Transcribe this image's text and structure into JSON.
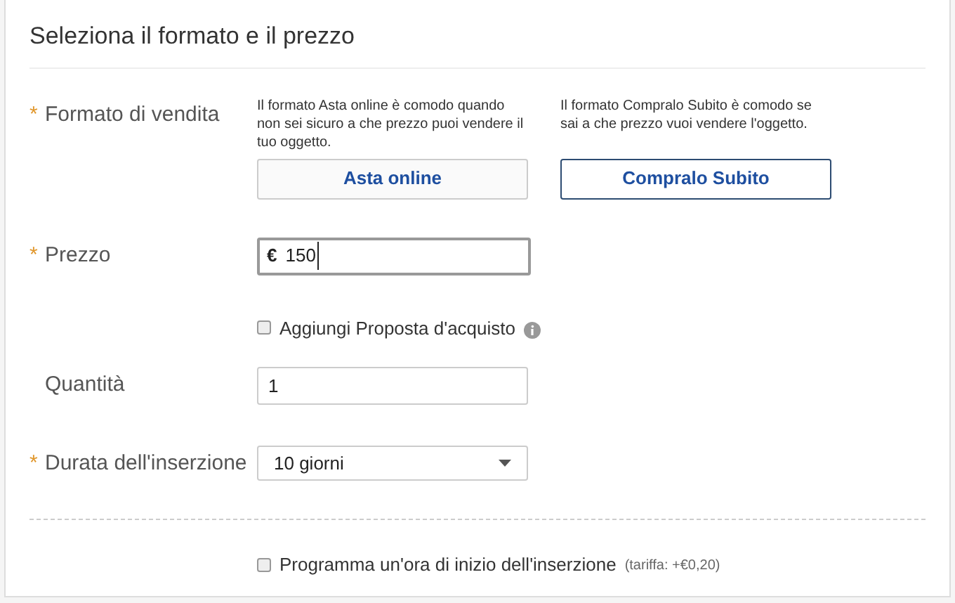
{
  "section": {
    "title": "Seleziona il formato e il prezzo"
  },
  "format": {
    "label": "Formato di vendita",
    "asterisk": "*",
    "options": [
      {
        "description": "Il formato Asta online è comodo quando non sei sicuro a che prezzo puoi vendere il tuo oggetto.",
        "button": "Asta online",
        "selected": false
      },
      {
        "description": "Il formato Compralo Subito è comodo se sai a che prezzo vuoi vendere l'oggetto.",
        "button": "Compralo Subito",
        "selected": true
      }
    ]
  },
  "price": {
    "label": "Prezzo",
    "asterisk": "*",
    "currency": "€",
    "value": "150"
  },
  "best_offer": {
    "label": "Aggiungi Proposta d'acquisto",
    "checked": false
  },
  "quantity": {
    "label": "Quantità",
    "value": "1"
  },
  "duration": {
    "label": "Durata dell'inserzione",
    "asterisk": "*",
    "value": "10 giorni"
  },
  "schedule": {
    "label": "Programma un'ora di inizio dell'inserzione",
    "fee": "(tariffa: +€0,20)",
    "checked": false
  }
}
